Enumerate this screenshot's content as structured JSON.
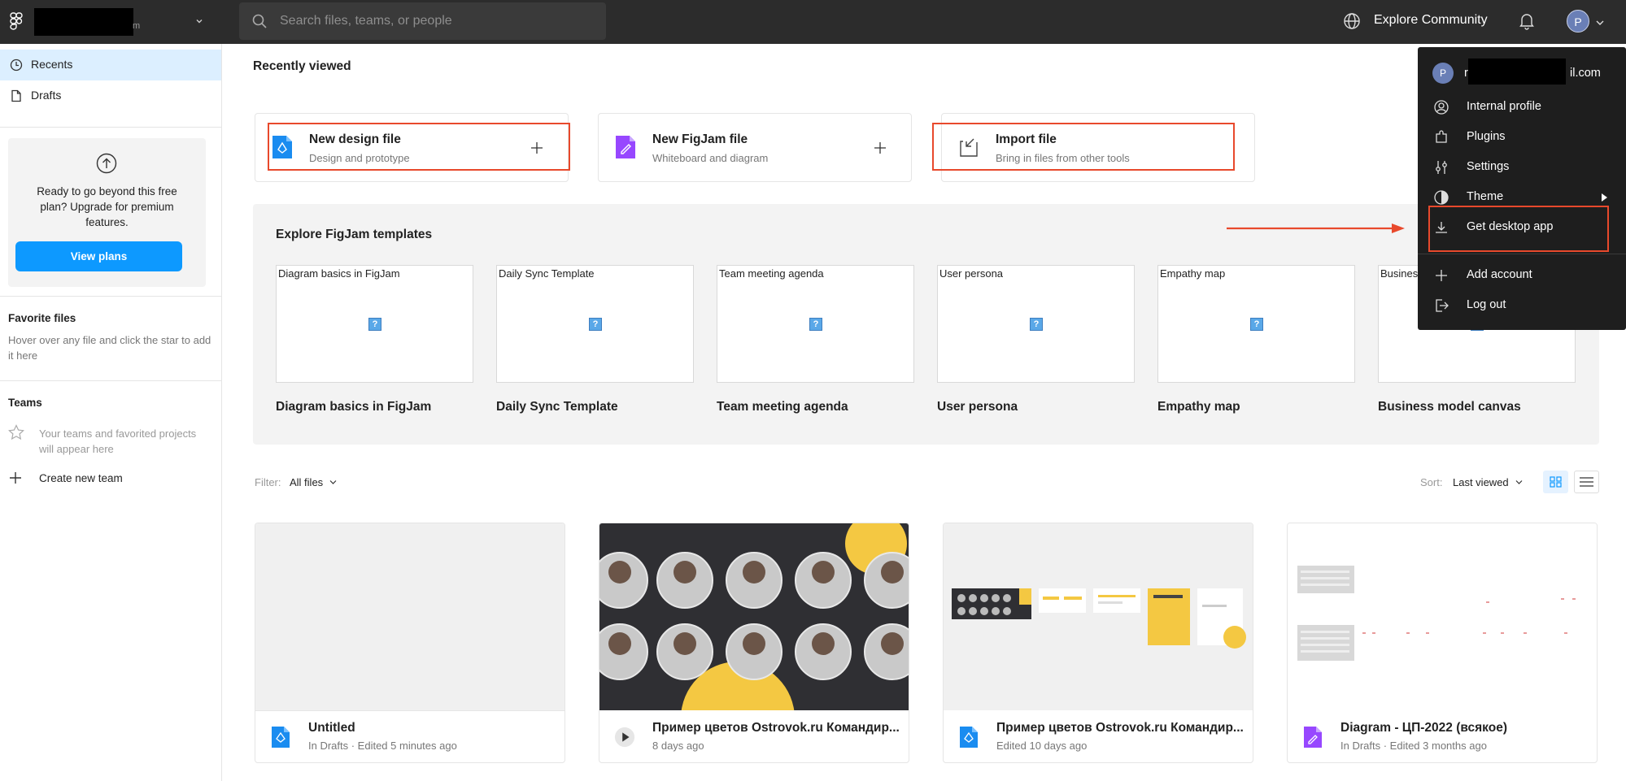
{
  "topbar": {
    "workspace_suffix": "m",
    "search_placeholder": "Search files, teams, or people",
    "explore_label": "Explore Community",
    "avatar_initial": "P"
  },
  "sidebar": {
    "items": [
      {
        "label": "Recents",
        "icon": "clock-icon"
      },
      {
        "label": "Drafts",
        "icon": "file-icon"
      }
    ],
    "upgrade": {
      "text": "Ready to go beyond this free plan? Upgrade for premium features.",
      "button": "View plans"
    },
    "favorites": {
      "heading": "Favorite files",
      "hint": "Hover over any file and click the star to add it here"
    },
    "teams": {
      "heading": "Teams",
      "hint": "Your teams and favorited projects will appear here",
      "create": "Create new team"
    }
  },
  "main": {
    "title": "Recently viewed",
    "create_cards": [
      {
        "title": "New design file",
        "subtitle": "Design and prototype",
        "icon": "design-file-icon"
      },
      {
        "title": "New FigJam file",
        "subtitle": "Whiteboard and diagram",
        "icon": "figjam-file-icon"
      },
      {
        "title": "Import file",
        "subtitle": "Bring in files from other tools",
        "icon": "import-icon"
      }
    ],
    "templates_title": "Explore FigJam templates",
    "templates": [
      {
        "thumb": "Diagram basics in FigJam",
        "name": "Diagram basics in FigJam"
      },
      {
        "thumb": "Daily Sync Template",
        "name": "Daily Sync Template"
      },
      {
        "thumb": "Team meeting agenda",
        "name": "Team meeting agenda"
      },
      {
        "thumb": "User persona",
        "name": "User persona"
      },
      {
        "thumb": "Empathy map",
        "name": "Empathy map"
      },
      {
        "thumb": "Busines",
        "name": "Business model canvas"
      }
    ],
    "filter_label": "Filter:",
    "filter_value": "All files",
    "sort_label": "Sort:",
    "sort_value": "Last viewed",
    "files": [
      {
        "name": "Untitled",
        "meta": "In Drafts · Edited 5 minutes ago",
        "icon": "design-file-icon"
      },
      {
        "name": "Пример цветов Ostrovok.ru Командир...",
        "meta": "8 days ago",
        "icon": "play-icon"
      },
      {
        "name": "Пример цветов Ostrovok.ru Командир...",
        "meta": "Edited 10 days ago",
        "icon": "design-file-icon"
      },
      {
        "name": "Diagram - ЦП-2022 (всякое)",
        "meta": "In Drafts · Edited 3 months ago",
        "icon": "figjam-file-icon"
      }
    ]
  },
  "menu": {
    "avatar_initial": "P",
    "email_prefix": "r",
    "email_suffix": "il.com",
    "items": [
      {
        "label": "Internal profile",
        "icon": "user-circle-icon"
      },
      {
        "label": "Plugins",
        "icon": "plugin-icon"
      },
      {
        "label": "Settings",
        "icon": "sliders-icon"
      },
      {
        "label": "Theme",
        "icon": "theme-icon"
      },
      {
        "label": "Get desktop app",
        "icon": "download-icon"
      },
      {
        "label": "Add account",
        "icon": "plus-icon"
      },
      {
        "label": "Log out",
        "icon": "logout-icon"
      }
    ]
  },
  "colors": {
    "accent": "#0d99ff",
    "annotation_red": "#e8492c",
    "figjam_purple": "#9747ff",
    "topbar": "#2c2c2c"
  }
}
